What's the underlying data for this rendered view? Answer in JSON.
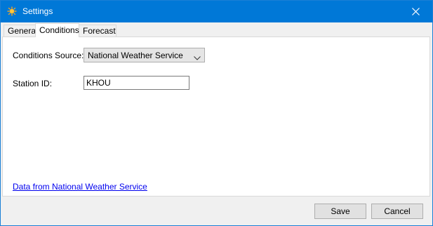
{
  "window": {
    "title": "Settings",
    "app_icon": "sun-icon",
    "close_icon": "close-icon"
  },
  "tabs": [
    {
      "label": "General"
    },
    {
      "label": "Conditions",
      "active": true
    },
    {
      "label": "Forecast"
    }
  ],
  "conditions": {
    "source_label": "Conditions Source:",
    "source_value": "National Weather Service",
    "station_label": "Station ID:",
    "station_value": "KHOU",
    "link_text": "Data from National Weather Service"
  },
  "footer": {
    "save_label": "Save",
    "cancel_label": "Cancel"
  }
}
